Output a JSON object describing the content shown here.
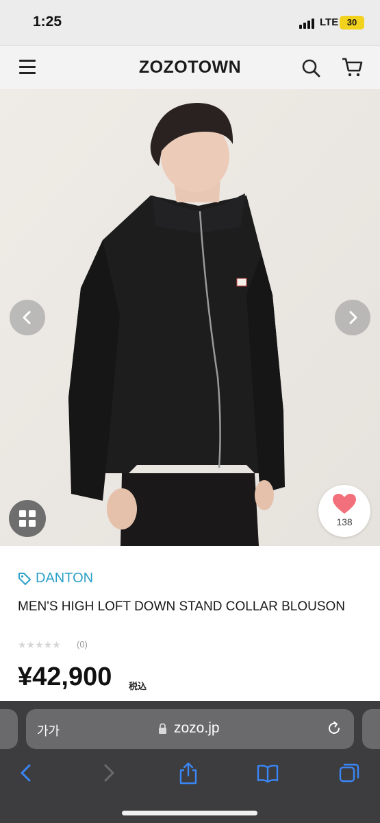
{
  "status_bar": {
    "time": "1:25",
    "network": "LTE",
    "battery": "30"
  },
  "header": {
    "logo": "ZOZOTOWN"
  },
  "gallery": {
    "favorite_count": "138"
  },
  "product": {
    "brand": "DANTON",
    "title": "MEN'S HIGH LOFT DOWN STAND COLLAR BLOUSON",
    "rating_stars": "★★★★★",
    "review_count": "(0)",
    "price": "¥42,900",
    "tax_label": "税込"
  },
  "browser": {
    "text_size_label": "가가",
    "url": "zozo.jp"
  },
  "colors": {
    "brand_link": "#2aa0c8",
    "favorite": "#f2707b",
    "browser_bg": "#3d3d3f",
    "browser_icons": "#3a86f7"
  }
}
